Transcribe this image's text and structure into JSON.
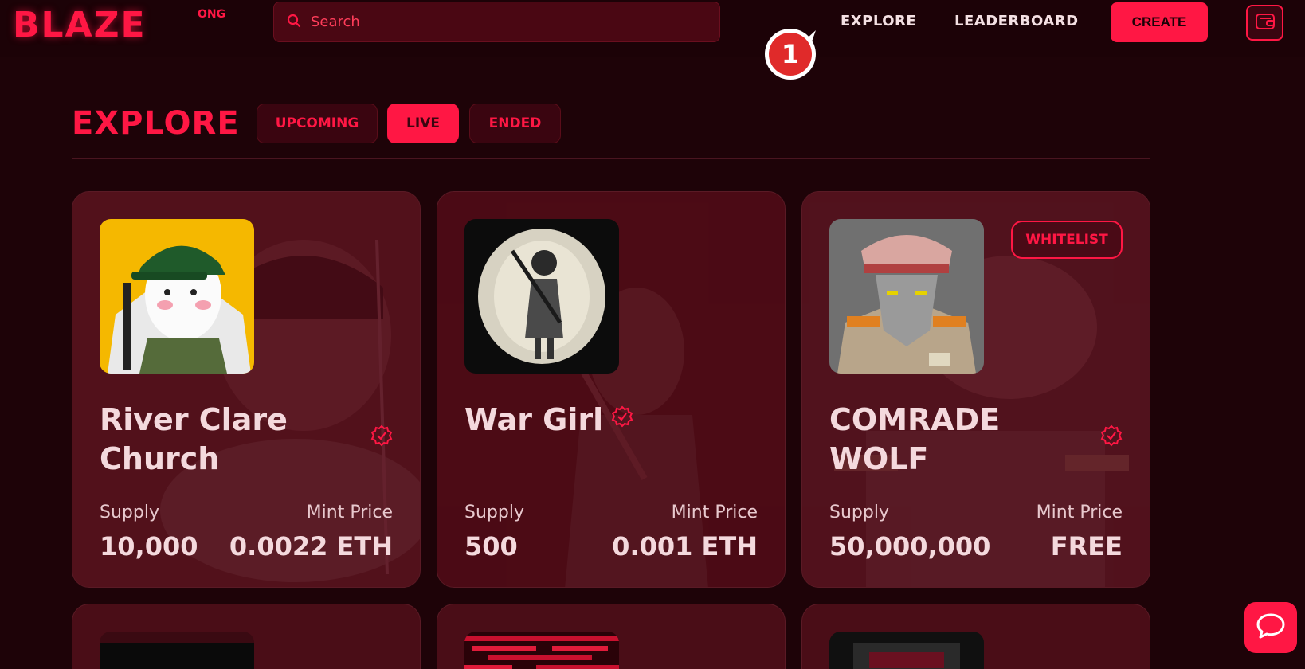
{
  "header": {
    "logo": "BLAZE",
    "logo_suffix": "ONG",
    "search_placeholder": "Search",
    "nav": [
      "EXPLORE",
      "LEADERBOARD"
    ],
    "create_label": "CREATE"
  },
  "marker": {
    "number": "1"
  },
  "page": {
    "title": "EXPLORE",
    "tabs": [
      {
        "label": "UPCOMING",
        "active": false
      },
      {
        "label": "LIVE",
        "active": true
      },
      {
        "label": "ENDED",
        "active": false
      }
    ]
  },
  "cards": [
    {
      "title": "River Clare Church",
      "supply_label": "Supply",
      "supply": "10,000",
      "price_label": "Mint Price",
      "price": "0.0022 ETH",
      "badge": ""
    },
    {
      "title": "War Girl",
      "supply_label": "Supply",
      "supply": "500",
      "price_label": "Mint Price",
      "price": "0.001 ETH",
      "badge": ""
    },
    {
      "title": "COMRADE WOLF",
      "supply_label": "Supply",
      "supply": "50,000,000",
      "price_label": "Mint Price",
      "price": "FREE",
      "badge": "WHITELIST"
    }
  ],
  "colors": {
    "accent": "#ff1744",
    "background": "#1e0308",
    "card": "#4a0d17"
  },
  "icons": {
    "search": "search-icon",
    "wallet": "wallet-icon",
    "verified": "verified-icon",
    "chat": "chat-icon"
  }
}
